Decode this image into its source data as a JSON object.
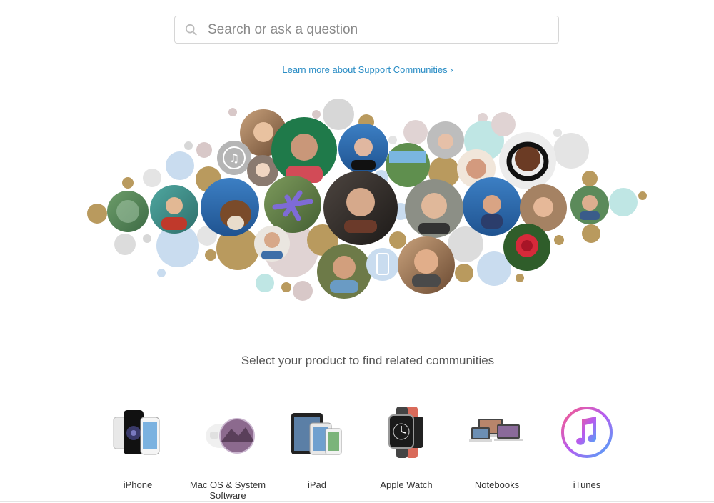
{
  "search": {
    "placeholder": "Search or ask a question"
  },
  "learn_more": {
    "label": "Learn more about Support Communities ›"
  },
  "section": {
    "title": "Select your product to find related communities"
  },
  "products": [
    {
      "label": "iPhone"
    },
    {
      "label": "Mac OS & System Software"
    },
    {
      "label": "iPad"
    },
    {
      "label": "Apple Watch"
    },
    {
      "label": "Notebooks"
    },
    {
      "label": "iTunes"
    }
  ],
  "colors": {
    "link": "#2a8dc5",
    "bubble_gold": "#b99a5e",
    "bubble_blue": "#c9dcef",
    "bubble_gray": "#d7d7d7",
    "bubble_mint": "#bfe6e4",
    "bubble_mauve": "#d8c8c8"
  }
}
